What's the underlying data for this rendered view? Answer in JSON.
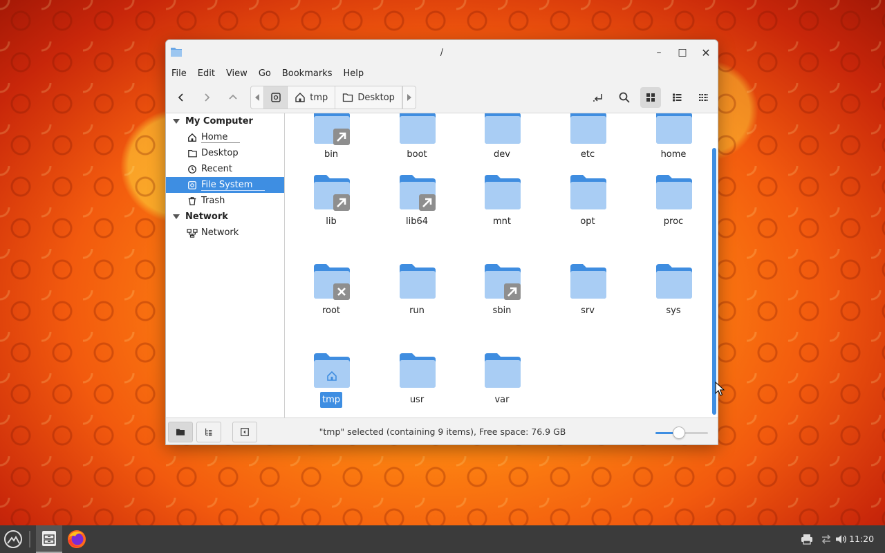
{
  "window": {
    "title": "/",
    "controls": {
      "minimize": "–",
      "maximize": "□",
      "close": "✕"
    }
  },
  "menubar": [
    "File",
    "Edit",
    "View",
    "Go",
    "Bookmarks",
    "Help"
  ],
  "toolbar": {
    "path_segments": [
      "tmp",
      "Desktop"
    ]
  },
  "sidebar": {
    "sections": [
      {
        "title": "My Computer",
        "items": [
          {
            "label": "Home",
            "icon": "home-icon",
            "selected": false
          },
          {
            "label": "Desktop",
            "icon": "folder-icon",
            "selected": false
          },
          {
            "label": "Recent",
            "icon": "clock-icon",
            "selected": false
          },
          {
            "label": "File System",
            "icon": "drive-icon",
            "selected": true
          },
          {
            "label": "Trash",
            "icon": "trash-icon",
            "selected": false
          }
        ]
      },
      {
        "title": "Network",
        "items": [
          {
            "label": "Network",
            "icon": "network-icon",
            "selected": false
          }
        ]
      }
    ]
  },
  "files": [
    {
      "name": "bin",
      "badge": "link"
    },
    {
      "name": "boot",
      "badge": ""
    },
    {
      "name": "dev",
      "badge": ""
    },
    {
      "name": "etc",
      "badge": ""
    },
    {
      "name": "home",
      "badge": ""
    },
    {
      "name": "lib",
      "badge": "link"
    },
    {
      "name": "lib64",
      "badge": "link"
    },
    {
      "name": "mnt",
      "badge": ""
    },
    {
      "name": "opt",
      "badge": ""
    },
    {
      "name": "proc",
      "badge": ""
    },
    {
      "name": "root",
      "badge": "locked"
    },
    {
      "name": "run",
      "badge": ""
    },
    {
      "name": "sbin",
      "badge": "link"
    },
    {
      "name": "srv",
      "badge": ""
    },
    {
      "name": "sys",
      "badge": ""
    },
    {
      "name": "tmp",
      "badge": "home",
      "selected": true
    },
    {
      "name": "usr",
      "badge": ""
    },
    {
      "name": "var",
      "badge": ""
    }
  ],
  "statusbar": {
    "text": "\"tmp\" selected (containing 9 items), Free space: 76.9 GB",
    "zoom_level": 0.45
  },
  "taskbar": {
    "clock": "11:20"
  },
  "colors": {
    "accent": "#3e8ee2",
    "folder_dark": "#3f8de0",
    "folder_light": "#a9cdf4"
  }
}
